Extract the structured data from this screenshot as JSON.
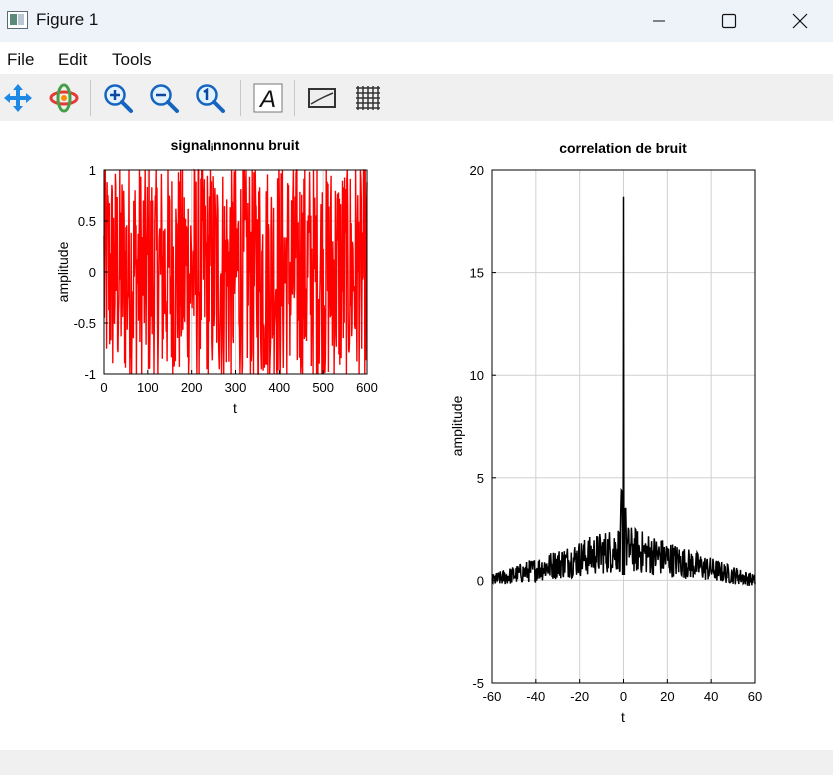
{
  "window": {
    "title": "Figure 1"
  },
  "menu": {
    "file": "File",
    "edit": "Edit",
    "tools": "Tools"
  },
  "toolbar": {
    "icons": [
      "pan-icon",
      "rotate-icon",
      "zoom-in-icon",
      "zoom-out-icon",
      "zoom-reset-icon",
      "text-icon",
      "axes-icon",
      "grid-icon"
    ],
    "text_glyph": "A"
  },
  "colors": {
    "signal": "#ff0000",
    "correlation": "#000000",
    "grid": "#d0d0d0"
  },
  "chart_data": [
    {
      "type": "line",
      "title": "signalᵢnnonnu bruit",
      "xlabel": "t",
      "ylabel": "amplitude",
      "xlim": [
        0,
        600
      ],
      "ylim": [
        -1,
        1
      ],
      "xticks": [
        "0",
        "100",
        "200",
        "300",
        "400",
        "500",
        "600"
      ],
      "yticks": [
        "1",
        "0.5",
        "0",
        "-0.5",
        "-1"
      ],
      "xtick_values": [
        0,
        100,
        200,
        300,
        400,
        500,
        600
      ],
      "ytick_values": [
        1,
        0.5,
        0,
        -0.5,
        -1
      ],
      "grid": true,
      "series": [
        {
          "color": "#ff0000",
          "n_points": 600,
          "distribution": "uniform random noise",
          "range": [
            -1,
            1
          ]
        }
      ]
    },
    {
      "type": "line",
      "title": "correlation de bruit",
      "xlabel": "t",
      "ylabel": "amplitude",
      "xlim": [
        -60,
        60
      ],
      "ylim": [
        -5,
        20
      ],
      "xticks": [
        "-60",
        "-40",
        "-20",
        "0",
        "20",
        "40",
        "60"
      ],
      "yticks": [
        "20",
        "15",
        "10",
        "5",
        "0",
        "-5"
      ],
      "xtick_values": [
        -60,
        -40,
        -20,
        0,
        20,
        40,
        60
      ],
      "ytick_values": [
        20,
        15,
        10,
        5,
        0,
        -5
      ],
      "grid": true,
      "peak": {
        "x": 0,
        "y": 18.7
      },
      "series": [
        {
          "color": "#000000",
          "x_range": [
            -60,
            60
          ],
          "shape": "autocorrelation with central peak"
        }
      ]
    }
  ]
}
